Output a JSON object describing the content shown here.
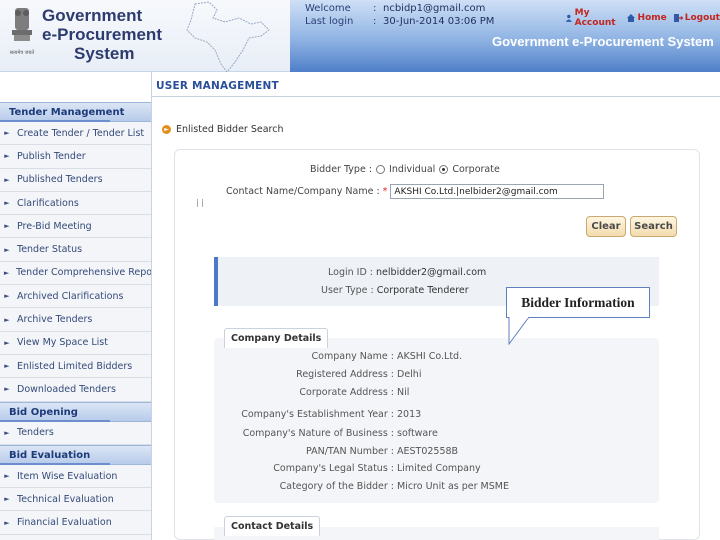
{
  "header": {
    "logo_lines": [
      "Government",
      "e-Procurement",
      "System"
    ],
    "welcome_label": "Welcome",
    "welcome_value": "ncbidp1@gmail.com",
    "last_login_label": "Last login",
    "last_login_value": "30-Jun-2014 03:06 PM",
    "links": [
      {
        "label": "My Account",
        "icon": "user-icon"
      },
      {
        "label": "Home",
        "icon": "home-icon"
      },
      {
        "label": "Logout",
        "icon": "logout-icon"
      }
    ],
    "system_title": "Government e-Procurement System"
  },
  "sidebar": {
    "sections": [
      {
        "title": "Tender Management",
        "items": [
          "Create Tender / Tender List",
          "Publish Tender",
          "Published Tenders",
          "Clarifications",
          "Pre-Bid Meeting",
          "Tender Status",
          "Tender Comprehensive Report",
          "Archived Clarifications",
          "Archive Tenders",
          "View My Space List",
          "Enlisted Limited Bidders",
          "Downloaded Tenders"
        ]
      },
      {
        "title": "Bid Opening",
        "items": [
          "Tenders"
        ]
      },
      {
        "title": "Bid Evaluation",
        "items": [
          "Item Wise Evaluation",
          "Technical Evaluation",
          "Financial Evaluation"
        ]
      }
    ]
  },
  "main": {
    "title": "USER MANAGEMENT",
    "subnav_label": "Enlisted Bidder Search",
    "bidder_type_label": "Bidder Type :",
    "bidder_type_options": [
      "Individual",
      "Corporate"
    ],
    "bidder_type_selected": "Corporate",
    "contact_label": "Contact Name/Company Name : ",
    "contact_required": "*",
    "contact_value": "AKSHI Co.Ltd.|nelbider2@gmail.com",
    "tiny_mark": "| |",
    "buttons": {
      "clear": "Clear",
      "search": "Search"
    },
    "login_info": [
      {
        "key": "Login ID :",
        "value": "nelbidder2@gmail.com"
      },
      {
        "key": "User Type :",
        "value": "Corporate Tenderer"
      }
    ],
    "callout": "Bidder Information",
    "company_tab": "Company Details",
    "company_fields": [
      {
        "key": "Company Name :",
        "value": "AKSHI Co.Ltd."
      },
      {
        "key": "Registered Address :",
        "value": "Delhi"
      },
      {
        "key": "Corporate Address :",
        "value": "Nil"
      },
      {
        "key": "Company's Establishment Year :",
        "value": "2013"
      },
      {
        "key": "Company's Nature of Business :",
        "value": "software"
      },
      {
        "key": "PAN/TAN Number :",
        "value": "AEST02558B"
      },
      {
        "key": "Company's Legal Status :",
        "value": "Limited Company"
      },
      {
        "key": "Category of the Bidder :",
        "value": "Micro Unit as per MSME"
      }
    ],
    "contact_tab": "Contact Details"
  },
  "colors": {
    "accent": "#2a4f9a",
    "header_band": "#4f7fc9",
    "link_red": "#c2261e",
    "button_bg": "#f3dcae"
  }
}
